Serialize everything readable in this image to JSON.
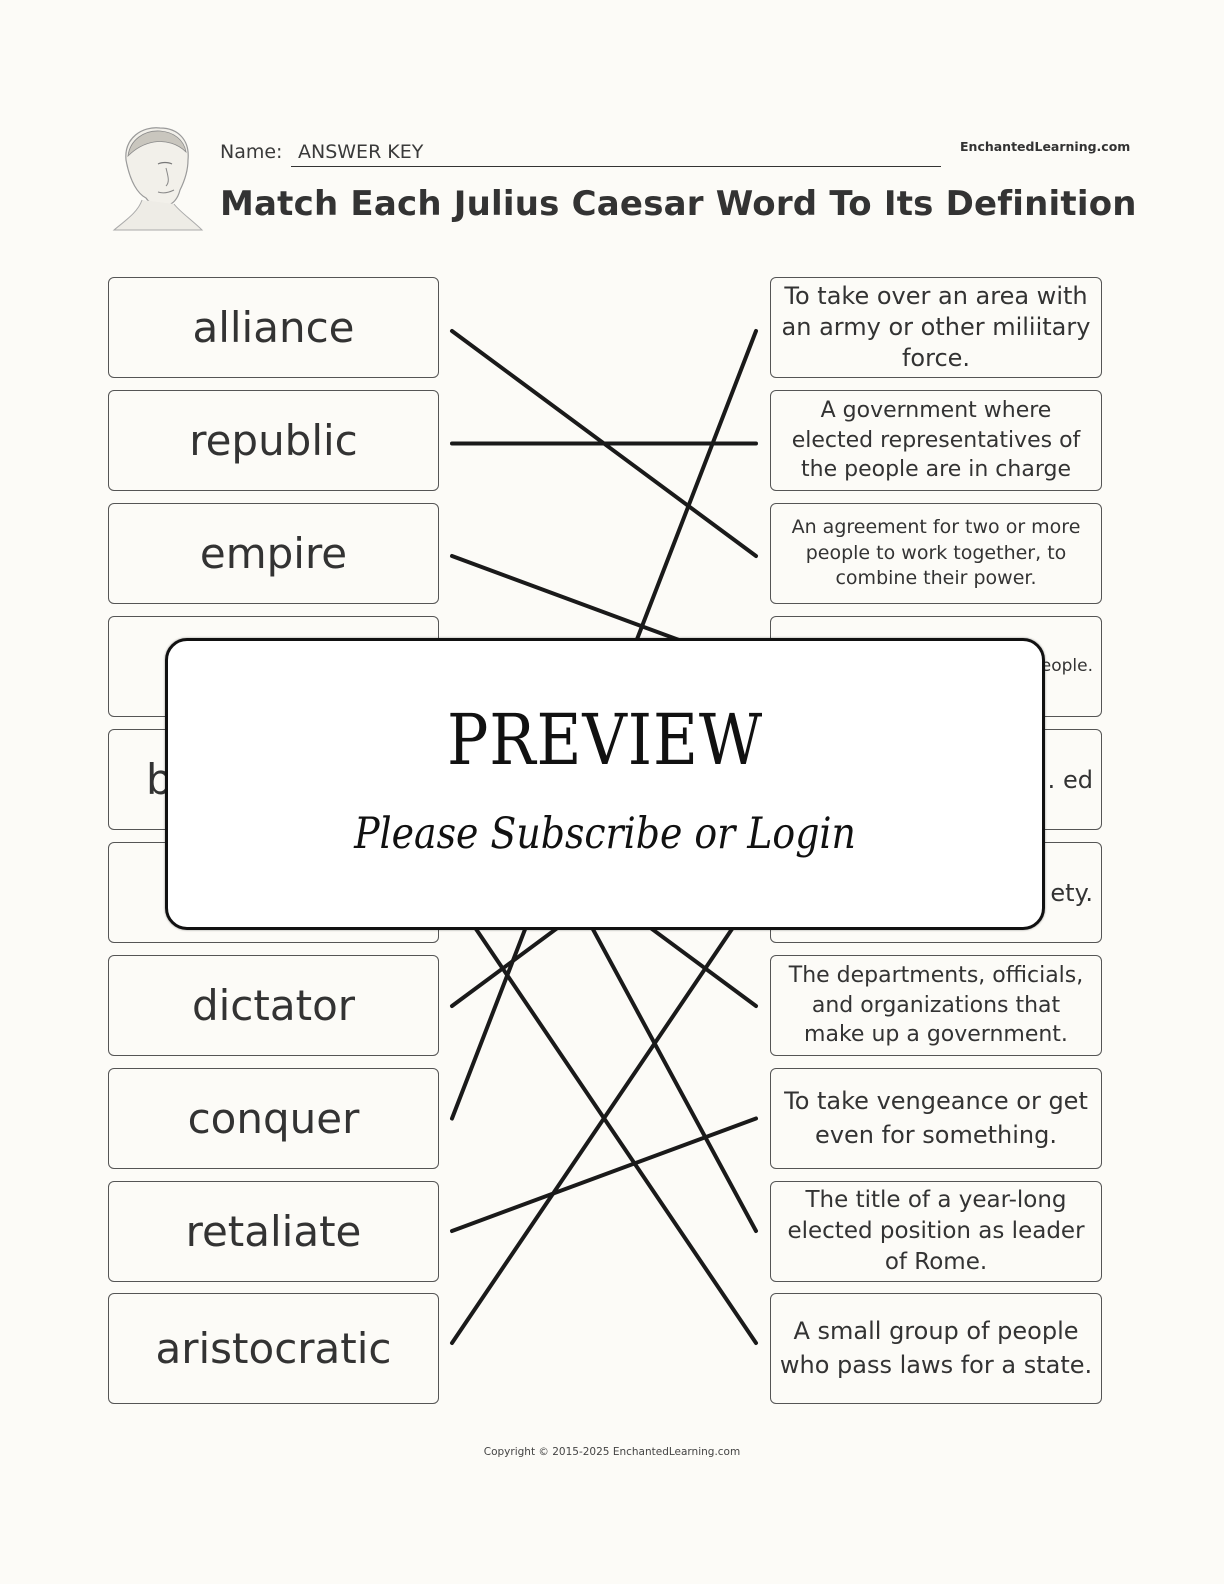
{
  "header": {
    "name_label": "Name:",
    "name_value": "ANSWER KEY",
    "site_tag": "EnchantedLearning.com",
    "title": "Match Each Julius Caesar Word To Its Definition",
    "portrait_icon": "julius-caesar-bust-portrait"
  },
  "words": [
    {
      "label": "alliance",
      "matches_definition": 3
    },
    {
      "label": "republic",
      "matches_definition": 2
    },
    {
      "label": "empire",
      "matches_definition": 4
    },
    {
      "label": "",
      "matches_definition": 9
    },
    {
      "label": "b",
      "matches_definition": 7
    },
    {
      "label": "",
      "matches_definition": 10
    },
    {
      "label": "dictator",
      "matches_definition": 5
    },
    {
      "label": "conquer",
      "matches_definition": 1
    },
    {
      "label": "retaliate",
      "matches_definition": 8
    },
    {
      "label": "aristocratic",
      "matches_definition": 6
    }
  ],
  "definitions": [
    {
      "text": "To take over an area with an army or other miliitary force."
    },
    {
      "text": "A government where elected representatives of the people are in charge"
    },
    {
      "text": "An agreement for two or more people to work together, to combine their power."
    },
    {
      "text": "that … eople."
    },
    {
      "text": "e … ed"
    },
    {
      "text": "te … ety."
    },
    {
      "text": "The departments, officials, and organizations that make up a government."
    },
    {
      "text": "To take vengeance or get even for something."
    },
    {
      "text": "The title of a year-long elected position as leader of Rome."
    },
    {
      "text": "A small group of people who pass laws for a state."
    }
  ],
  "overlay": {
    "title": "PREVIEW",
    "subtitle": "Please Subscribe or Login"
  },
  "footer": {
    "copyright": "Copyright © 2015-2025 EnchantedLearning.com"
  },
  "colors": {
    "background": "#fcfbf7",
    "text": "#333333",
    "line": "#1a1a1a"
  }
}
